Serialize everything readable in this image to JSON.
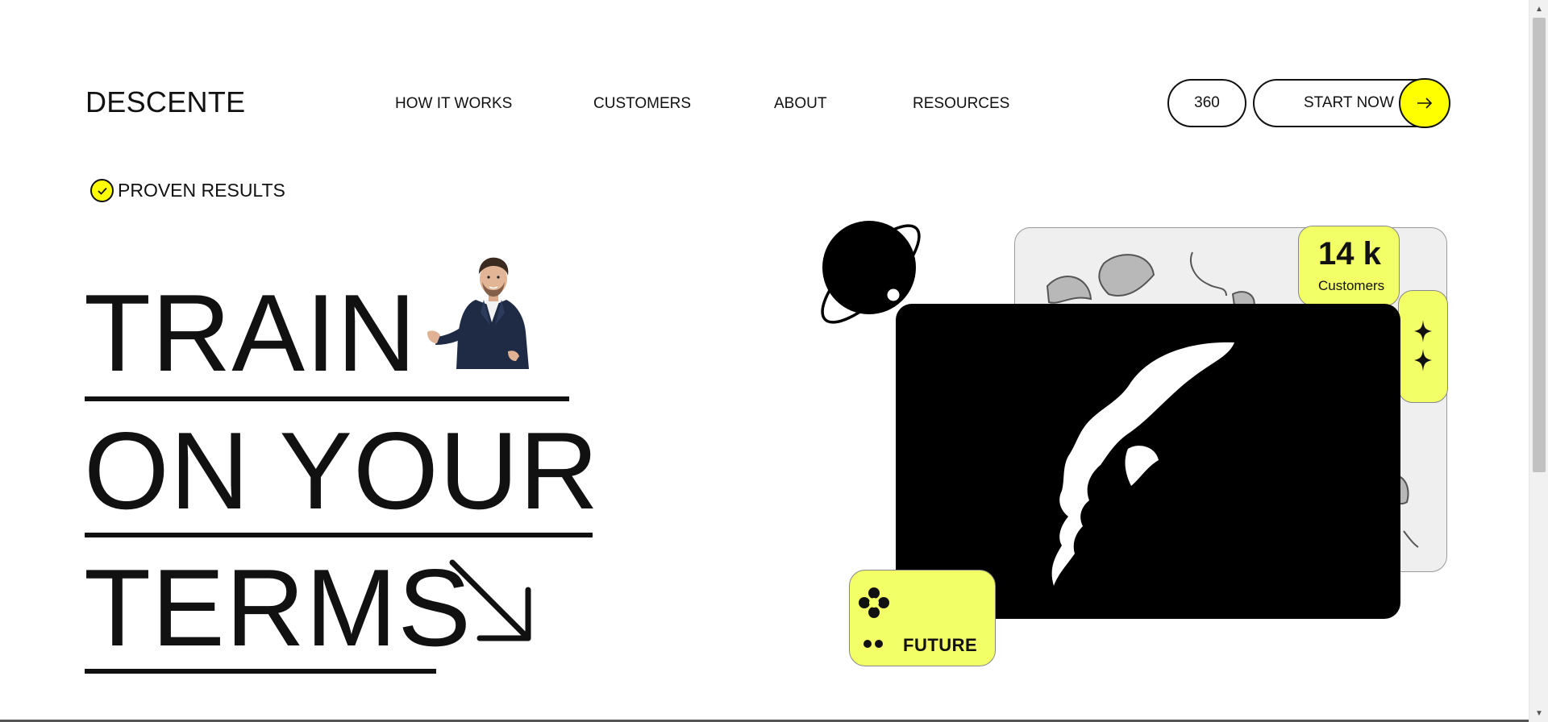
{
  "header": {
    "brand": "DESCENTE",
    "nav": [
      {
        "label": "HOW IT WORKS"
      },
      {
        "label": "CUSTOMERS"
      },
      {
        "label": "ABOUT"
      },
      {
        "label": "RESOURCES"
      }
    ],
    "pill_360": "360",
    "start_now": "START NOW",
    "arrow_icon": "arrow-right-icon"
  },
  "hero": {
    "badge": "PROVEN RESULTS",
    "badge_icon": "check-circle-icon",
    "line1": "TRAIN",
    "line2": "ON YOUR",
    "line3": "TERMS",
    "person_image": "businessman-presenting",
    "arrow_icon": "arrow-down-right-icon"
  },
  "graphic": {
    "stat_value": "14 k",
    "stat_label": "Customers",
    "future_label": "FUTURE",
    "icons": [
      "planet-icon",
      "sparkles-icon",
      "flower-icon",
      "dots-icon"
    ]
  },
  "colors": {
    "accent": "#ffff00",
    "tab": "#f2ff66",
    "ink": "#111111"
  }
}
